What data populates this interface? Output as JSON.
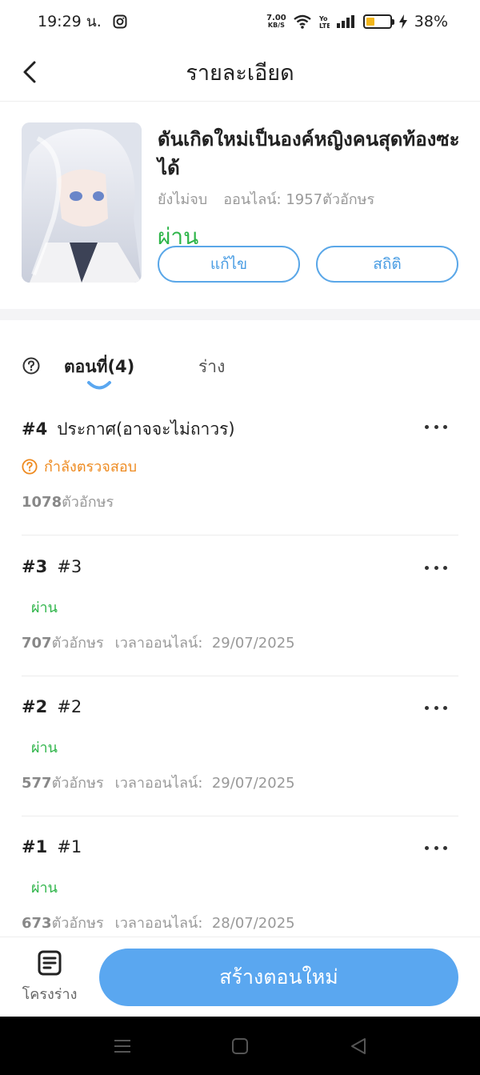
{
  "status_bar": {
    "time": "19:29 น.",
    "net_speed_value": "7.00",
    "net_speed_unit": "KB/S",
    "battery_percent": "38%",
    "battery_level": 0.38,
    "icons": [
      "instagram-icon",
      "wifi-icon",
      "volte-icon",
      "signal-icon",
      "battery-icon",
      "charging-icon"
    ]
  },
  "header": {
    "title": "รายละเอียด"
  },
  "book": {
    "title": "ดันเกิดใหม่เป็นองค์หญิงคนสุดท้องซะได้",
    "progress": "ยังไม่จบ",
    "online": "ออนไลน์: 1957ตัวอักษร",
    "status": "ผ่าน",
    "edit_label": "แก้ไข",
    "stats_label": "สถิติ"
  },
  "tabs": {
    "chapters_label": "ตอนที่(4)",
    "drafts_label": "ร่าง"
  },
  "chapters": [
    {
      "number": "#4",
      "name": "ประกาศ(อาจจะไม่ถาวร)",
      "status": "กำลังตรวจสอบ",
      "status_kind": "review",
      "count": "1078",
      "count_unit": "ตัวอักษร",
      "time_label": "",
      "date": ""
    },
    {
      "number": "#3",
      "name": "#3",
      "status": "ผ่าน",
      "status_kind": "pass",
      "count": "707",
      "count_unit": "ตัวอักษร",
      "time_label": "เวลาออนไลน์:",
      "date": "29/07/2025"
    },
    {
      "number": "#2",
      "name": "#2",
      "status": "ผ่าน",
      "status_kind": "pass",
      "count": "577",
      "count_unit": "ตัวอักษร",
      "time_label": "เวลาออนไลน์:",
      "date": "29/07/2025"
    },
    {
      "number": "#1",
      "name": "#1",
      "status": "ผ่าน",
      "status_kind": "pass",
      "count": "673",
      "count_unit": "ตัวอักษร",
      "time_label": "เวลาออนไลน์:",
      "date": "28/07/2025"
    }
  ],
  "bottom": {
    "draft_nav_label": "โครงร่าง",
    "create_label": "สร้างตอนใหม่"
  },
  "colors": {
    "accent": "#5aa7f0",
    "pass": "#2fb54a",
    "review": "#ee8a1f"
  }
}
